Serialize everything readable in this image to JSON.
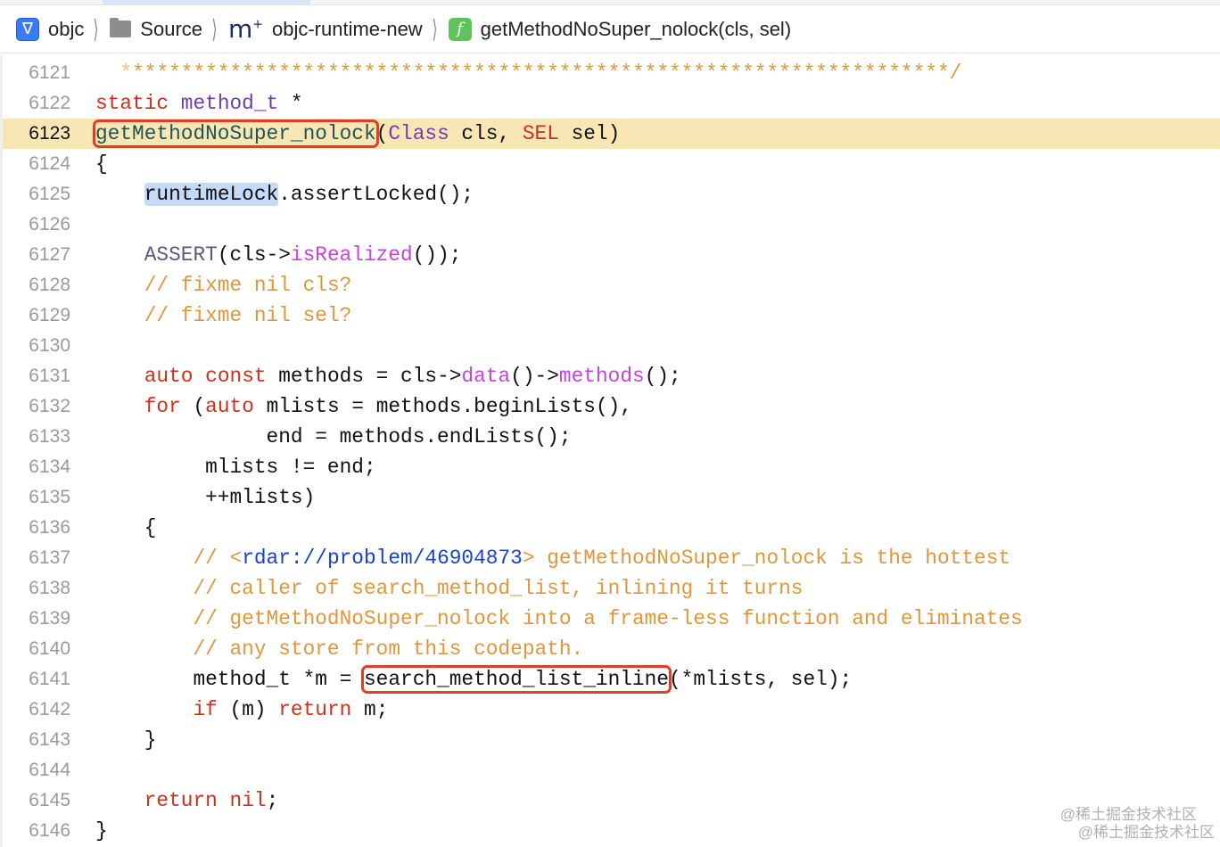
{
  "breadcrumb": [
    {
      "label": "objc",
      "icon": "app-project-icon"
    },
    {
      "label": "Source",
      "icon": "folder-icon"
    },
    {
      "label": "objc-runtime-new",
      "icon": "objc-source-file-icon"
    },
    {
      "label": "getMethodNoSuper_nolock(cls, sel)",
      "icon": "function-icon"
    }
  ],
  "colors": {
    "keyword": "#d12f1b",
    "type": "#703daa",
    "comment": "#e0963a",
    "method": "#c543e0",
    "url": "#1640d6",
    "current_line": "#f8e6b5",
    "annotation_box": "#e53d22"
  },
  "current_line": "6123",
  "lines": [
    {
      "n": "6121",
      "t": [
        [
          "  ",
          "faint"
        ],
        [
          "*",
          "faint"
        ],
        [
          "*******************************************************************/",
          "cm"
        ]
      ]
    },
    {
      "n": "6122",
      "t": [
        [
          "static",
          "kw"
        ],
        [
          " ",
          ""
        ],
        [
          "method_t",
          "ty"
        ],
        [
          " *",
          ""
        ]
      ]
    },
    {
      "n": "6123",
      "t": [
        [
          "getMethodNoSuper_nolock",
          "decl box"
        ],
        [
          "(",
          ""
        ],
        [
          "Class",
          "ty"
        ],
        [
          " cls, ",
          ""
        ],
        [
          "SEL",
          "kw"
        ],
        [
          " sel)",
          ""
        ]
      ]
    },
    {
      "n": "6124",
      "t": [
        [
          "{",
          ""
        ]
      ]
    },
    {
      "n": "6125",
      "t": [
        [
          "    ",
          ""
        ],
        [
          "runtimeLock",
          "hl"
        ],
        [
          ".assertLocked();",
          ""
        ]
      ]
    },
    {
      "n": "6126",
      "t": []
    },
    {
      "n": "6127",
      "t": [
        [
          "    ",
          ""
        ],
        [
          "ASSERT",
          "mac"
        ],
        [
          "(cls->",
          ""
        ],
        [
          "isRealized",
          "fn"
        ],
        [
          "());",
          ""
        ]
      ]
    },
    {
      "n": "6128",
      "t": [
        [
          "    ",
          ""
        ],
        [
          "// fixme nil cls?",
          "cm"
        ]
      ]
    },
    {
      "n": "6129",
      "t": [
        [
          "    ",
          ""
        ],
        [
          "// fixme nil sel?",
          "cm"
        ]
      ]
    },
    {
      "n": "6130",
      "t": []
    },
    {
      "n": "6131",
      "t": [
        [
          "    ",
          ""
        ],
        [
          "auto",
          "kw"
        ],
        [
          " ",
          ""
        ],
        [
          "const",
          "kw"
        ],
        [
          " methods = cls->",
          ""
        ],
        [
          "data",
          "fn"
        ],
        [
          "()->",
          ""
        ],
        [
          "methods",
          "fn"
        ],
        [
          "();",
          ""
        ]
      ]
    },
    {
      "n": "6132",
      "t": [
        [
          "    ",
          ""
        ],
        [
          "for",
          "kw"
        ],
        [
          " (",
          ""
        ],
        [
          "auto",
          "kw"
        ],
        [
          " mlists = methods.beginLists(),",
          ""
        ]
      ]
    },
    {
      "n": "6133",
      "t": [
        [
          "              end = methods.endLists();",
          ""
        ]
      ]
    },
    {
      "n": "6134",
      "t": [
        [
          "         mlists != end;",
          ""
        ]
      ]
    },
    {
      "n": "6135",
      "t": [
        [
          "         ++mlists)",
          ""
        ]
      ]
    },
    {
      "n": "6136",
      "t": [
        [
          "    {",
          ""
        ]
      ]
    },
    {
      "n": "6137",
      "t": [
        [
          "        ",
          ""
        ],
        [
          "// ",
          "cm"
        ],
        [
          "<",
          "cm"
        ],
        [
          "rdar://problem/46904873",
          "url"
        ],
        [
          "> getMethodNoSuper_nolock is the hottest",
          "cm"
        ]
      ]
    },
    {
      "n": "6138",
      "t": [
        [
          "        ",
          ""
        ],
        [
          "// caller of search_method_list, inlining it turns",
          "cm"
        ]
      ]
    },
    {
      "n": "6139",
      "t": [
        [
          "        ",
          ""
        ],
        [
          "// getMethodNoSuper_nolock into a frame-less function and eliminates",
          "cm"
        ]
      ]
    },
    {
      "n": "6140",
      "t": [
        [
          "        ",
          ""
        ],
        [
          "// any store from this codepath.",
          "cm"
        ]
      ]
    },
    {
      "n": "6141",
      "t": [
        [
          "        method_t *m = ",
          ""
        ],
        [
          "search_method_list_inline",
          "box"
        ],
        [
          "(*mlists, sel);",
          ""
        ]
      ]
    },
    {
      "n": "6142",
      "t": [
        [
          "        ",
          ""
        ],
        [
          "if",
          "kw"
        ],
        [
          " (m) ",
          ""
        ],
        [
          "return",
          "kw"
        ],
        [
          " m;",
          ""
        ]
      ]
    },
    {
      "n": "6143",
      "t": [
        [
          "    }",
          ""
        ]
      ]
    },
    {
      "n": "6144",
      "t": []
    },
    {
      "n": "6145",
      "t": [
        [
          "    ",
          ""
        ],
        [
          "return",
          "kw"
        ],
        [
          " ",
          ""
        ],
        [
          "nil",
          "kw"
        ],
        [
          ";",
          ""
        ]
      ]
    },
    {
      "n": "6146",
      "t": [
        [
          "}",
          ""
        ]
      ]
    }
  ],
  "watermark": "@稀土掘金技术社区"
}
